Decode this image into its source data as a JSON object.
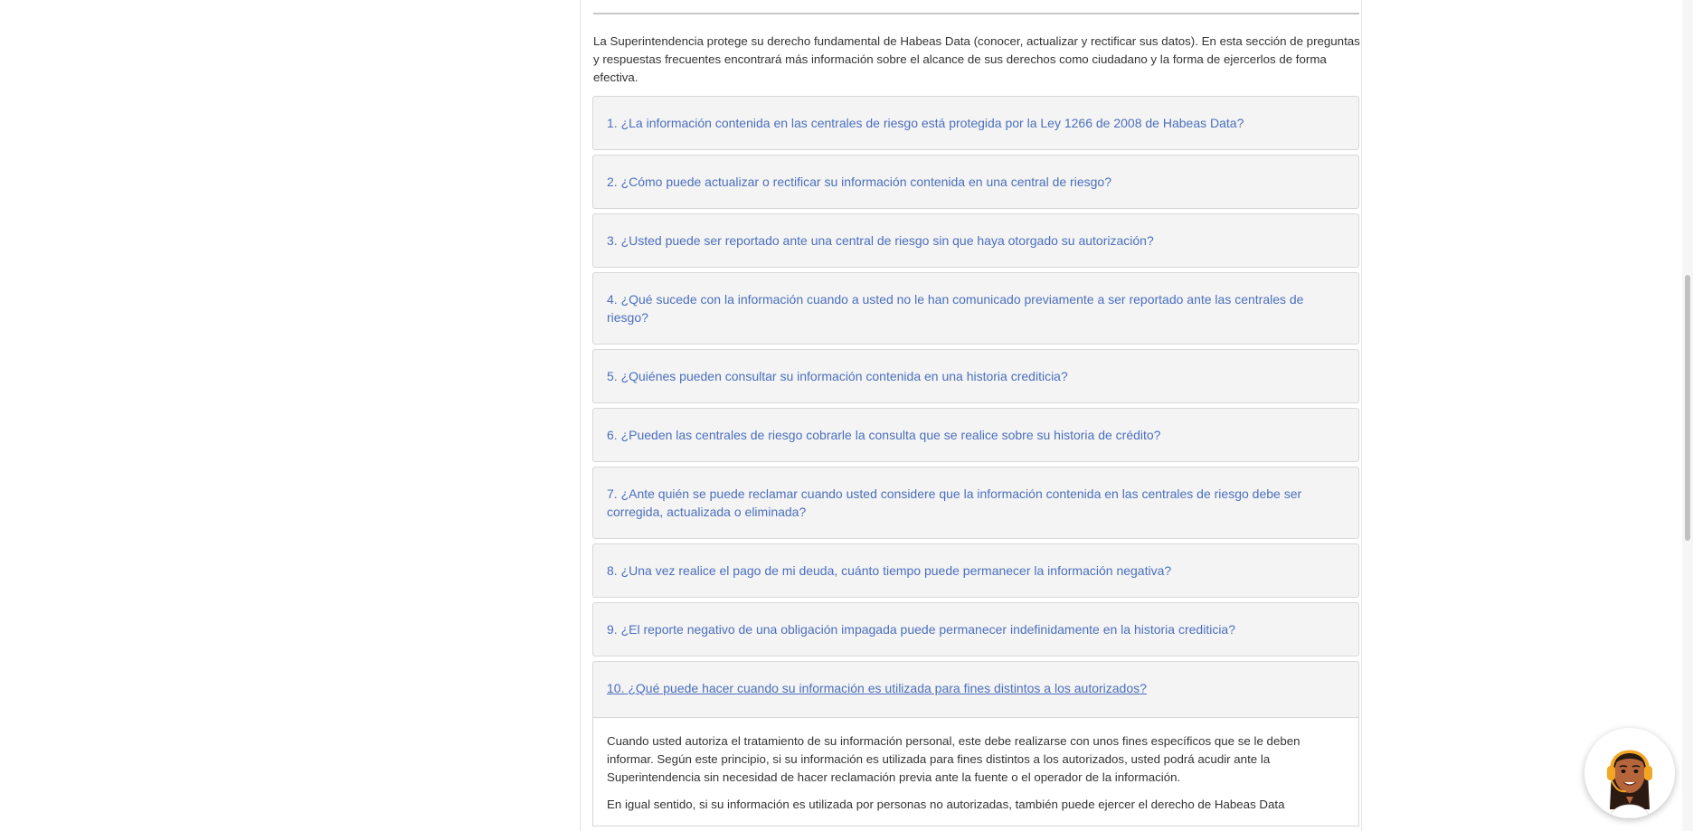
{
  "intro_text": "La Superintendencia protege su derecho fundamental de Habeas Data (conocer, actualizar y rectificar sus datos). En esta sección de preguntas y respuestas frecuentes encontrará más información sobre el alcance de sus derechos como ciudadano y la forma de ejercerlos de forma efectiva.",
  "faq": [
    {
      "question": "1. ¿La información contenida en las centrales de riesgo está protegida por la Ley 1266 de 2008 de Habeas Data?"
    },
    {
      "question": "2. ¿Cómo puede actualizar o rectificar su información contenida en una central de riesgo?"
    },
    {
      "question": "3. ¿Usted puede ser reportado ante una central de riesgo sin que haya otorgado su autorización?"
    },
    {
      "question": "4. ¿Qué sucede con la información cuando a usted no le han comunicado previamente a ser reportado ante las centrales de riesgo?"
    },
    {
      "question": "5. ¿Quiénes pueden consultar su información contenida en una historia crediticia?"
    },
    {
      "question": "6. ¿Pueden las centrales de riesgo cobrarle la consulta que se realice sobre su historia de crédito?"
    },
    {
      "question": "7. ¿Ante quién se puede reclamar cuando usted considere que la información contenida en las centrales de riesgo debe ser corregida, actualizada o eliminada?"
    },
    {
      "question": "8. ¿Una vez realice el pago de mi deuda, cuánto tiempo puede permanecer la información negativa?"
    },
    {
      "question": "9. ¿El reporte negativo de una obligación impagada puede permanecer indefinidamente en la historia crediticia?"
    },
    {
      "question": "10. ¿Qué puede hacer cuando su información es utilizada para fines distintos a los autorizados?"
    }
  ],
  "open_answer": {
    "paragraph_1": "Cuando usted autoriza el tratamiento de su información personal, este debe realizarse con unos fines específicos que se le deben informar. Según este principio, si su información es utilizada para fines distintos a los autorizados, usted podrá acudir ante la Superintendencia sin necesidad de hacer reclamación previa ante la fuente o el operador de la información.",
    "paragraph_2": "En igual sentido, si su información es utilizada por personas no autorizadas, también puede ejercer el derecho de Habeas Data"
  },
  "chat_widget": {
    "icon": "assistant-avatar-icon"
  },
  "colors": {
    "link": "#4b6fbd",
    "panel": "#f4f4f4",
    "border": "#d7d7d7",
    "text": "#333333"
  }
}
